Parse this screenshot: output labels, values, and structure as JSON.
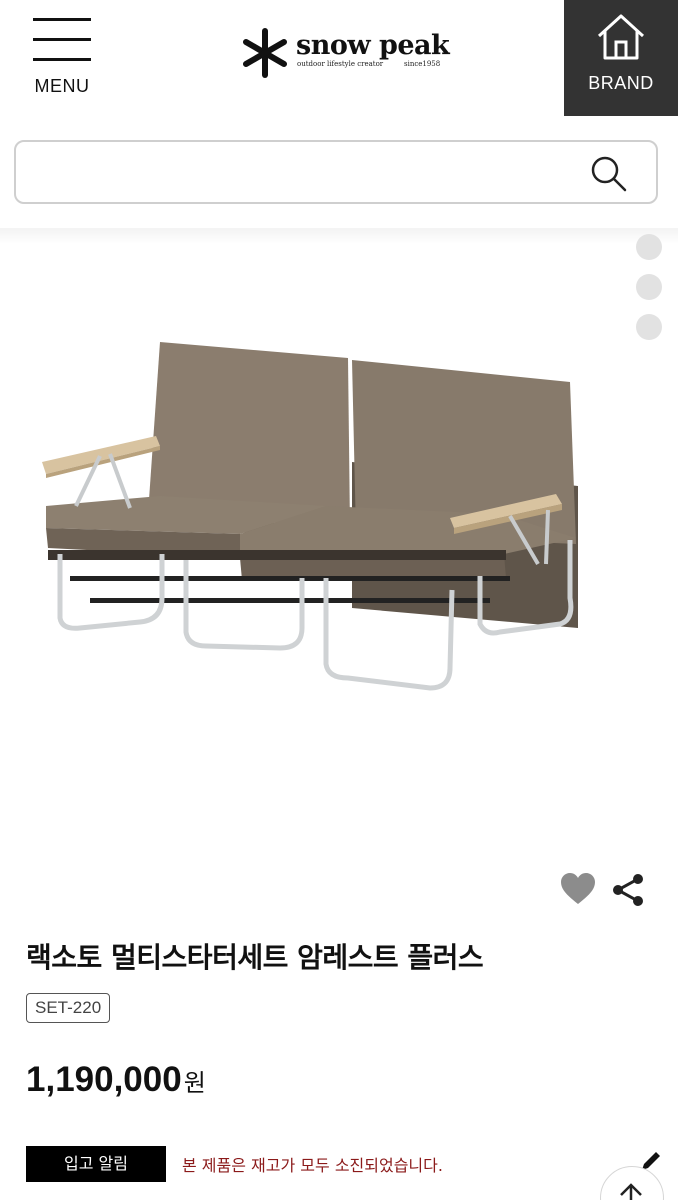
{
  "header": {
    "menu_label": "MENU",
    "brand_label": "BRAND",
    "logo": {
      "name": "snow peak",
      "tagline": "outdoor lifestyle creator",
      "since": "since1958"
    }
  },
  "search": {
    "value": "",
    "placeholder": "",
    "icon": "search-icon"
  },
  "gallery": {
    "dots": [
      1,
      2,
      3
    ],
    "icons": [
      "heart-icon",
      "share-icon"
    ]
  },
  "product": {
    "title": "랙소토 멀티스타터세트 암레스트 플러스",
    "sku": "SET-220",
    "price": "1,190,000",
    "currency": "원",
    "restock_button": "입고 알림",
    "soldout_message": "본 제품은 재고가 모두 소진되었습니다."
  },
  "colors": {
    "brand_button_bg": "#333333",
    "soldout_text": "#8b1a1a",
    "cushion": "#8b7d6e",
    "armrest_wood": "#d8c3a0"
  }
}
